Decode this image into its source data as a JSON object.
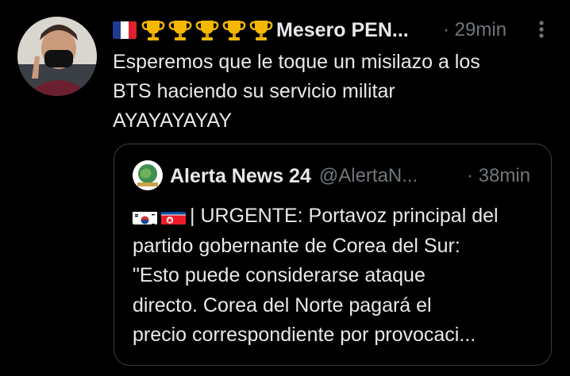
{
  "tweet": {
    "display_name": "Mesero PEN...",
    "time_separator": "·",
    "time": "29min",
    "text_lines": [
      "Esperemos que le toque un misilazo a los",
      "BTS haciendo su servicio militar",
      "AYAYAYAYAY"
    ],
    "name_emojis": [
      "flag-france-icon",
      "trophy-icon",
      "trophy-icon",
      "trophy-icon",
      "trophy-icon",
      "trophy-icon"
    ]
  },
  "quote": {
    "display_name": "Alerta News 24",
    "handle": "@AlertaN...",
    "time_separator": "·",
    "time": "38min",
    "leading_emojis": [
      "flag-south-korea-icon",
      "flag-north-korea-icon"
    ],
    "first_line": "| URGENTE: Portavoz principal del",
    "text_lines": [
      "partido gobernante de Corea del Sur:",
      "\"Esto puede considerarse ataque",
      "directo. Corea del Norte pagará el",
      "precio correspondiente por provocaci..."
    ]
  },
  "colors": {
    "background": "#000000",
    "text_primary": "#e7e9ea",
    "text_secondary": "#71767b",
    "card_border": "#3a3f44",
    "trophy_gold": "#f5b800"
  }
}
